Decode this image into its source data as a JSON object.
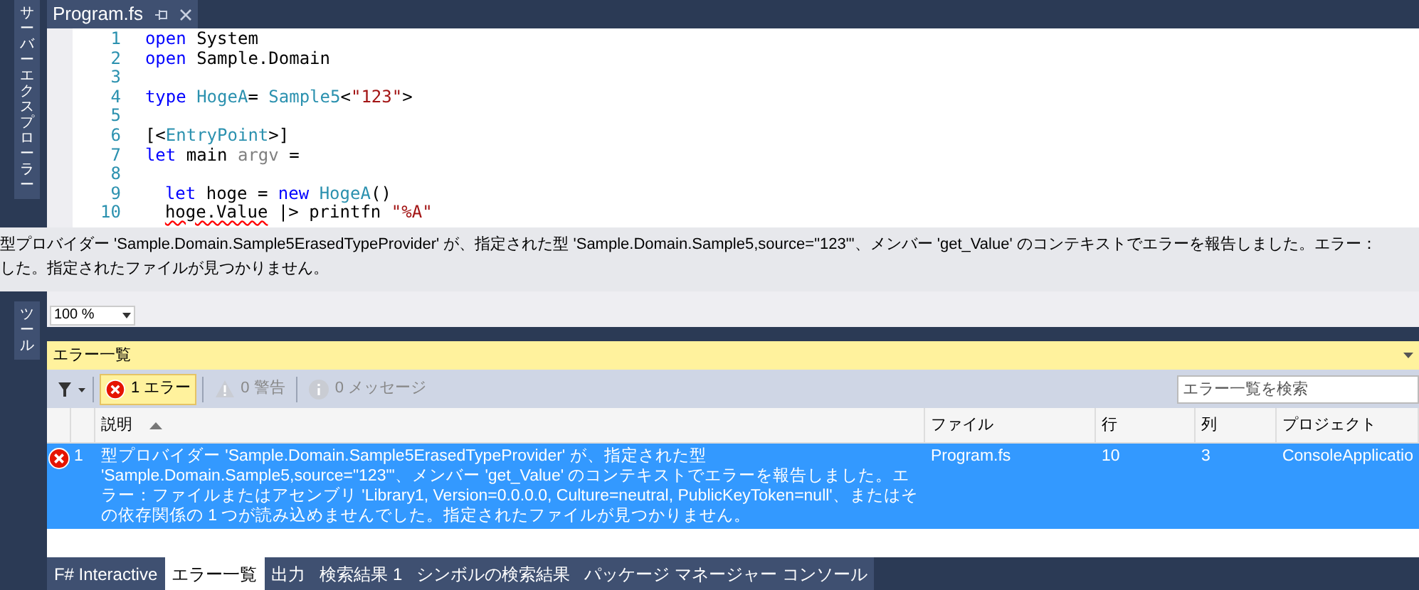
{
  "side_tabs": [
    {
      "label": "サーバーエクスプローラー"
    },
    {
      "label": "ツール"
    }
  ],
  "editor_tab": {
    "title": "Program.fs"
  },
  "code": {
    "lines": [
      {
        "number": "1",
        "tokens": [
          {
            "text": "open",
            "kind": "keyword"
          },
          {
            "text": " System",
            "kind": "plain"
          }
        ]
      },
      {
        "number": "2",
        "tokens": [
          {
            "text": "open",
            "kind": "keyword"
          },
          {
            "text": " Sample.Domain",
            "kind": "plain"
          }
        ]
      },
      {
        "number": "3"
      },
      {
        "number": "4",
        "tokens": [
          {
            "text": "type",
            "kind": "keyword"
          },
          {
            "text": " HogeA",
            "kind": "type"
          },
          {
            "text": "= ",
            "kind": "plain"
          },
          {
            "text": "Sample5",
            "kind": "type"
          },
          {
            "text": "<",
            "kind": "plain"
          },
          {
            "text": "\"123\"",
            "kind": "string"
          },
          {
            "text": ">",
            "kind": "plain"
          }
        ]
      },
      {
        "number": "5"
      },
      {
        "number": "6",
        "tokens": [
          {
            "text": "[<",
            "kind": "plain"
          },
          {
            "text": "EntryPoint",
            "kind": "type"
          },
          {
            "text": ">]",
            "kind": "plain"
          }
        ]
      },
      {
        "number": "7",
        "tokens": [
          {
            "text": "let",
            "kind": "keyword"
          },
          {
            "text": " main ",
            "kind": "plain"
          },
          {
            "text": "argv",
            "kind": "param"
          },
          {
            "text": " =",
            "kind": "plain"
          }
        ]
      },
      {
        "number": "8"
      },
      {
        "number": "9",
        "indented": true,
        "tokens": [
          {
            "text": "let",
            "kind": "keyword"
          },
          {
            "text": " hoge = ",
            "kind": "plain"
          },
          {
            "text": "new",
            "kind": "keyword"
          },
          {
            "text": " HogeA",
            "kind": "type"
          },
          {
            "text": "()",
            "kind": "plain"
          }
        ]
      },
      {
        "number": "10",
        "indented": true,
        "tokens": [
          {
            "text": "hoge.Value",
            "kind": "error"
          },
          {
            "text": " |> printfn ",
            "kind": "plain"
          },
          {
            "text": "\"%A\"",
            "kind": "string"
          }
        ]
      }
    ]
  },
  "tooltip": {
    "lines": [
      "型プロバイダー 'Sample.Domain.Sample5ErasedTypeProvider' が、指定された型 'Sample.Domain.Sample5,source=\"123\"'、メンバー 'get_Value' のコンテキストでエラーを報告しました。エラー：",
      "した。指定されたファイルが見つかりません。"
    ]
  },
  "zoom": {
    "value": "100 %"
  },
  "error_list": {
    "title": "エラー一覧",
    "filters": [
      {
        "kind": "error",
        "count": "1",
        "label": "エラー",
        "selected": true
      },
      {
        "kind": "warning",
        "count": "0",
        "label": "警告",
        "selected": false
      },
      {
        "kind": "info",
        "count": "0",
        "label": "メッセージ",
        "selected": false
      }
    ],
    "search": {
      "placeholder": "エラー一覧を検索"
    },
    "columns": [
      {
        "label": "説明",
        "sorted": true
      },
      {
        "label": "ファイル",
        "sorted": false
      },
      {
        "label": "行",
        "sorted": false
      },
      {
        "label": "列",
        "sorted": false
      },
      {
        "label": "プロジェクト",
        "sorted": false
      }
    ],
    "rows": [
      {
        "selected": true,
        "number": "1",
        "description": "型プロバイダー 'Sample.Domain.Sample5ErasedTypeProvider' が、指定された型 'Sample.Domain.Sample5,source=\"123\"'、メンバー 'get_Value' のコンテキストでエラーを報告しました。エラー：ファイルまたはアセンブリ 'Library1, Version=0.0.0.0, Culture=neutral, PublicKeyToken=null'、またはその依存関係の 1 つが読み込めませんでした。指定されたファイルが見つかりません。",
        "file": "Program.fs",
        "line": "10",
        "column": "3",
        "project": "ConsoleApplicatio"
      }
    ]
  },
  "bottom_tabs": [
    {
      "label": "F# Interactive",
      "selected": false
    },
    {
      "label": "エラー一覧",
      "selected": true
    },
    {
      "label": "出力",
      "selected": false
    },
    {
      "label": "検索結果 1",
      "selected": false
    },
    {
      "label": "シンボルの検索結果",
      "selected": false
    },
    {
      "label": "パッケージ マネージャー コンソール",
      "selected": false
    }
  ]
}
